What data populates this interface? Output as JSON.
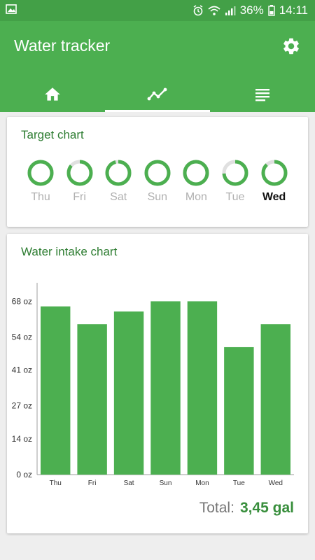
{
  "status": {
    "battery": "36%",
    "time": "14:11"
  },
  "app": {
    "title": "Water tracker"
  },
  "tabs": [
    {
      "icon": "home-icon",
      "active": false
    },
    {
      "icon": "chart-line-icon",
      "active": true
    },
    {
      "icon": "list-icon",
      "active": false
    }
  ],
  "target_chart": {
    "title": "Target chart",
    "days": [
      {
        "label": "Thu",
        "fraction": 1.0,
        "today": false
      },
      {
        "label": "Fri",
        "fraction": 0.86,
        "today": false
      },
      {
        "label": "Sat",
        "fraction": 0.96,
        "today": false
      },
      {
        "label": "Sun",
        "fraction": 1.0,
        "today": false
      },
      {
        "label": "Mon",
        "fraction": 1.0,
        "today": false
      },
      {
        "label": "Tue",
        "fraction": 0.74,
        "today": false
      },
      {
        "label": "Wed",
        "fraction": 0.88,
        "today": true
      }
    ]
  },
  "intake_chart": {
    "title": "Water intake chart",
    "total_label": "Total:",
    "total_value": "3,45 gal"
  },
  "colors": {
    "accent": "#4caf50",
    "ring_track": "#e0e0e0",
    "title_green": "#2e7d32"
  },
  "chart_data": {
    "type": "bar",
    "categories": [
      "Thu",
      "Fri",
      "Sat",
      "Sun",
      "Mon",
      "Tue",
      "Wed"
    ],
    "values": [
      66,
      59,
      64,
      68,
      68,
      50,
      59
    ],
    "y_ticks": [
      "0 oz",
      "14 oz",
      "27 oz",
      "41 oz",
      "54 oz",
      "68 oz"
    ],
    "y_tick_values": [
      0,
      14,
      27,
      41,
      54,
      68
    ],
    "ylim": [
      0,
      78
    ],
    "grid": false
  }
}
